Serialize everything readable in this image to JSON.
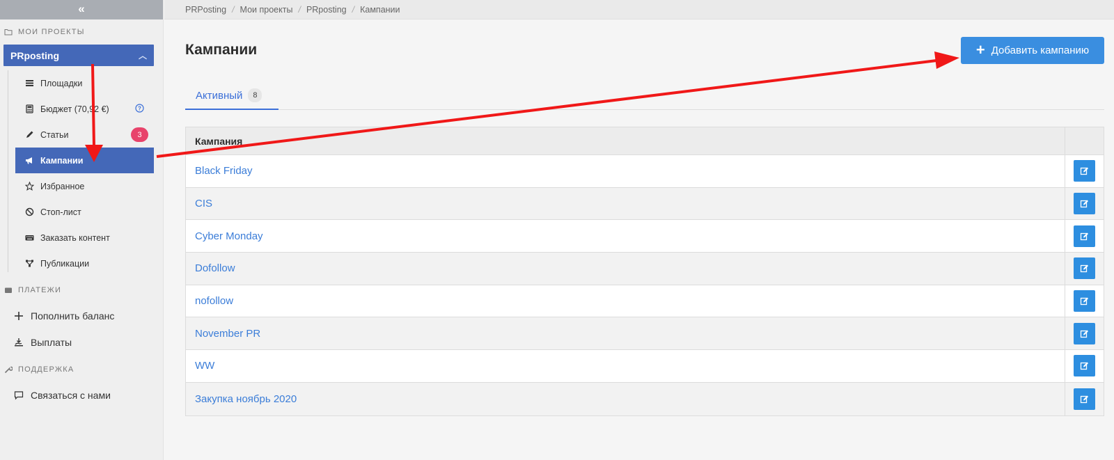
{
  "sidebar": {
    "collapse_label": "«",
    "projects_section": "МОИ ПРОЕКТЫ",
    "project_name": "PRposting",
    "items": [
      {
        "label": "Площадки",
        "icon": "list-icon"
      },
      {
        "label": "Бюджет (70,92 €)",
        "icon": "calculator-icon"
      },
      {
        "label": "Статьи",
        "icon": "pencil-icon",
        "badge": "3"
      },
      {
        "label": "Кампании",
        "icon": "megaphone-icon",
        "active": true
      },
      {
        "label": "Избранное",
        "icon": "star-icon"
      },
      {
        "label": "Стоп-лист",
        "icon": "ban-icon"
      },
      {
        "label": "Заказать контент",
        "icon": "keyboard-icon"
      },
      {
        "label": "Публикации",
        "icon": "network-icon"
      }
    ],
    "payments_section": "ПЛАТЕЖИ",
    "payments_items": [
      {
        "label": "Пополнить баланс",
        "icon": "plus-icon"
      },
      {
        "label": "Выплаты",
        "icon": "payout-icon"
      }
    ],
    "support_section": "ПОДДЕРЖКА",
    "support_items": [
      {
        "label": "Связаться с нами",
        "icon": "chat-icon"
      }
    ]
  },
  "breadcrumb": [
    "PRPosting",
    "Мои проекты",
    "PRposting",
    "Кампании"
  ],
  "page": {
    "title": "Кампании",
    "add_button": "Добавить кампанию"
  },
  "tabs": [
    {
      "label": "Активный",
      "count": "8"
    }
  ],
  "table": {
    "header": "Кампания",
    "rows": [
      "Black Friday",
      "CIS",
      "Cyber Monday",
      "Dofollow",
      "nofollow",
      "November PR",
      "WW",
      "Закупка ноябрь 2020"
    ]
  },
  "colors": {
    "accent": "#4468b8",
    "button": "#3a8ee0",
    "link": "#3b7dd8",
    "badge": "#e8436b",
    "annotation": "#f01818"
  }
}
